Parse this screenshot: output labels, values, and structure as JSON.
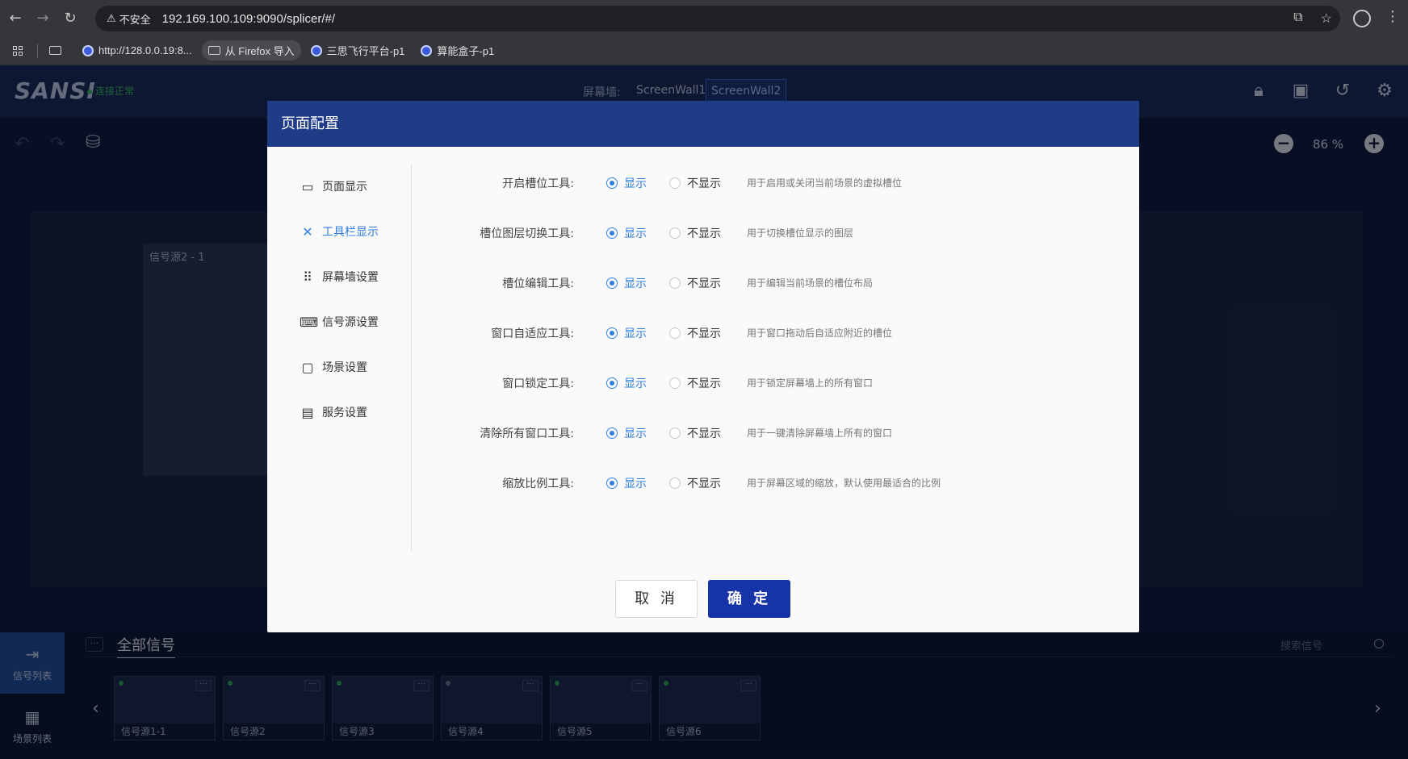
{
  "browser": {
    "security_label": "不安全",
    "url": "192.169.100.109:9090/splicer/#/",
    "bookmarks": [
      {
        "label": "http://128.0.0.19:8..."
      },
      {
        "label": "从 Firefox 导入"
      },
      {
        "label": "三思飞行平台-p1"
      },
      {
        "label": "算能盒子-p1"
      }
    ]
  },
  "header": {
    "logo": "SANSI",
    "status": "连接正常",
    "wall_label": "屏幕墙:",
    "walls": [
      "ScreenWall1",
      "ScreenWall2"
    ],
    "active_wall": "ScreenWall2"
  },
  "workspace": {
    "zoom_value": "86 %",
    "signal_window_label": "信号源2 - 1"
  },
  "bottom": {
    "tab_signal_list": "信号列表",
    "tab_scene_list": "场景列表",
    "all_signals": "全部信号",
    "search_placeholder": "搜索信号",
    "more": "···",
    "sources": [
      {
        "label": "信号源1-1",
        "online": true
      },
      {
        "label": "信号源2",
        "online": true
      },
      {
        "label": "信号源3",
        "online": true
      },
      {
        "label": "信号源4",
        "online": false
      },
      {
        "label": "信号源5",
        "online": true
      },
      {
        "label": "信号源6",
        "online": true
      }
    ]
  },
  "modal": {
    "title": "页面配置",
    "nav": [
      {
        "label": "页面显示",
        "icon": "monitor-icon"
      },
      {
        "label": "工具栏显示",
        "icon": "tools-icon"
      },
      {
        "label": "屏幕墙设置",
        "icon": "grid-dots-icon"
      },
      {
        "label": "信号源设置",
        "icon": "keyboard-icon"
      },
      {
        "label": "场景设置",
        "icon": "scene-icon"
      },
      {
        "label": "服务设置",
        "icon": "server-icon"
      }
    ],
    "active_nav": "工具栏显示",
    "show_label": "显示",
    "hide_label": "不显示",
    "rows": [
      {
        "label": "开启槽位工具:",
        "desc": "用于启用或关闭当前场景的虚拟槽位",
        "value": "show"
      },
      {
        "label": "槽位图层切换工具:",
        "desc": "用于切换槽位显示的图层",
        "value": "show"
      },
      {
        "label": "槽位编辑工具:",
        "desc": "用于编辑当前场景的槽位布局",
        "value": "show"
      },
      {
        "label": "窗口自适应工具:",
        "desc": "用于窗口拖动后自适应附近的槽位",
        "value": "show"
      },
      {
        "label": "窗口锁定工具:",
        "desc": "用于锁定屏幕墙上的所有窗口",
        "value": "show"
      },
      {
        "label": "清除所有窗口工具:",
        "desc": "用于一键清除屏幕墙上所有的窗口",
        "value": "show"
      },
      {
        "label": "缩放比例工具:",
        "desc": "用于屏幕区域的缩放，默认使用最适合的比例",
        "value": "show"
      }
    ],
    "cancel_label": "取 消",
    "ok_label": "确 定"
  },
  "colors": {
    "header_bg": "#1a2b5c",
    "modal_header": "#1f3d86",
    "accent": "#2f7fe0",
    "ok_button": "#1733a8"
  }
}
